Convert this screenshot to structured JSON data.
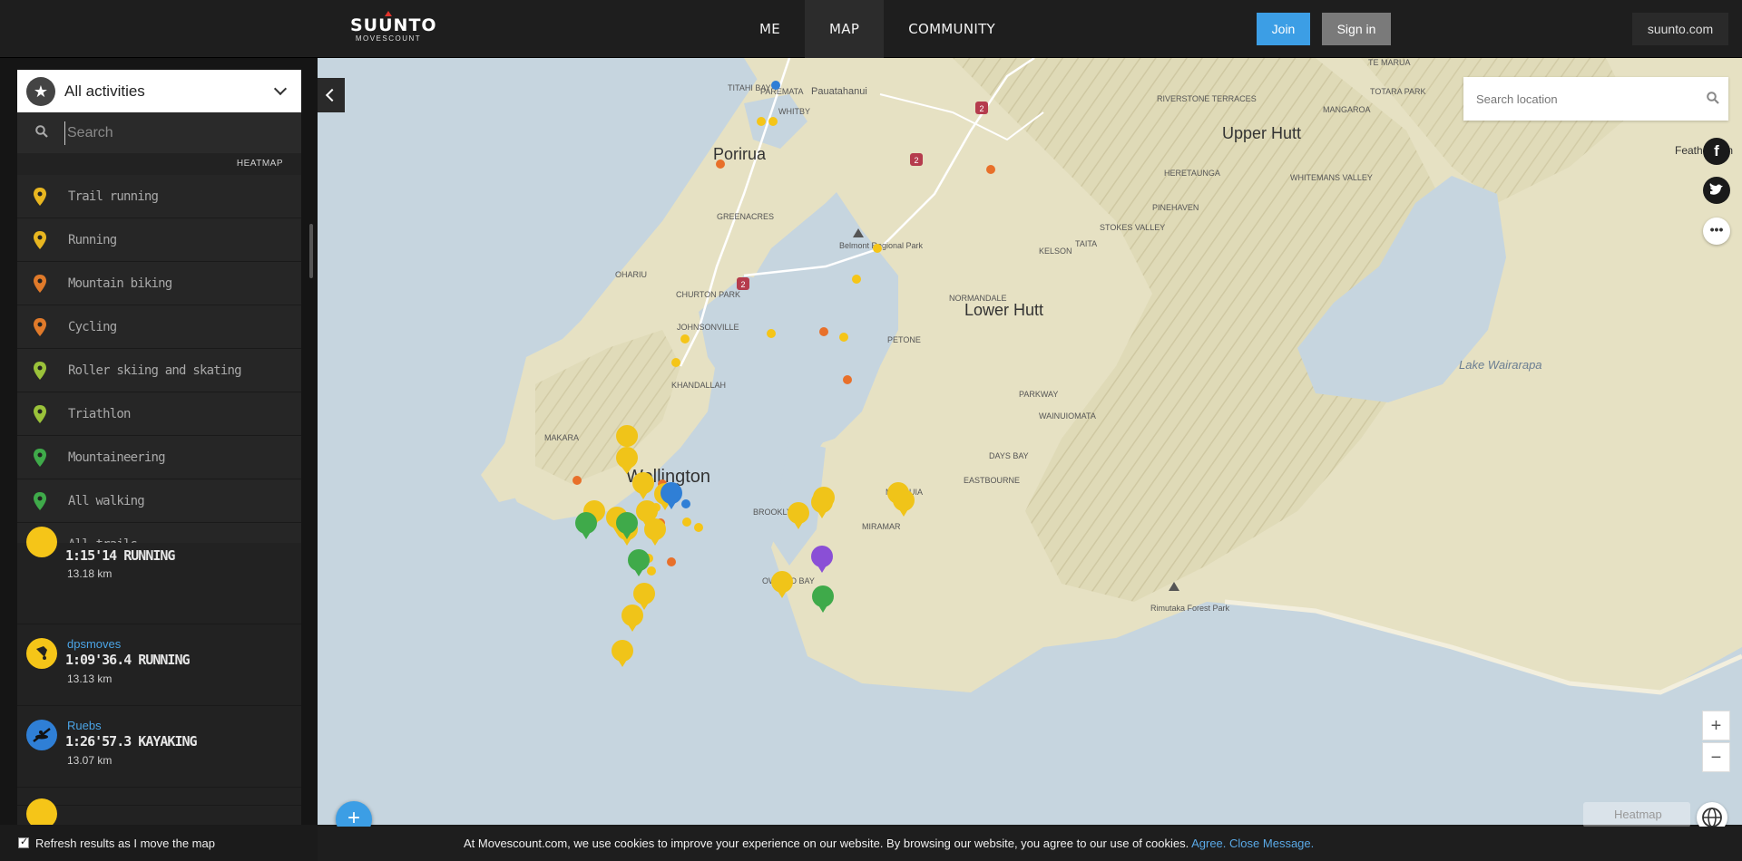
{
  "header": {
    "brand": "SUUNTO",
    "brand_sub": "MOVESCOUNT",
    "nav": [
      {
        "label": "ME"
      },
      {
        "label": "MAP"
      },
      {
        "label": "COMMUNITY"
      }
    ],
    "join_label": "Join",
    "signin_label": "Sign in",
    "site_link": "suunto.com"
  },
  "sidebar": {
    "activity_select": "All activities",
    "search_placeholder": "Search",
    "heatmap_header": "HEATMAP",
    "activities": [
      {
        "label": "Trail running",
        "color": "#e8b620"
      },
      {
        "label": "Running",
        "color": "#e8b620"
      },
      {
        "label": "Mountain biking",
        "color": "#e07a2a"
      },
      {
        "label": "Cycling",
        "color": "#e07a2a"
      },
      {
        "label": "Roller skiing and skating",
        "color": "#9ac23a"
      },
      {
        "label": "Triathlon",
        "color": "#9ac23a"
      },
      {
        "label": "Mountaineering",
        "color": "#3faa4a"
      },
      {
        "label": "All walking",
        "color": "#3faa4a"
      },
      {
        "label": "All trails",
        "color": "#3faa4a"
      }
    ],
    "feed": [
      {
        "user": "",
        "time": "1:15'14 RUNNING",
        "distance": "13.18 km",
        "color": "#f5c518"
      },
      {
        "user": "dpsmoves",
        "time": "1:09'36.4 RUNNING",
        "distance": "13.13 km",
        "color": "#f5c518"
      },
      {
        "user": "Ruebs",
        "time": "1:26'57.3 KAYAKING",
        "distance": "13.07 km",
        "color": "#2f7fd6"
      }
    ],
    "refresh_label": "Refresh results as I move the map",
    "refresh_checked": true
  },
  "map": {
    "search_placeholder": "Search location",
    "places": {
      "porirua": "Porirua",
      "upper_hutt": "Upper Hutt",
      "lower_hutt": "Lower Hutt",
      "wellington": "Wellington",
      "lake": "Lake Wairarapa",
      "belmont": "Belmont Regional Park",
      "rimutaka": "Rimutaka Forest Park",
      "titahi": "TITAHI BAY",
      "pauatahanui": "Pauatahanui",
      "whitby": "WHITBY",
      "paremata": "PAREMATA",
      "greenacres": "GREENACRES",
      "ohariu": "OHARIU",
      "churton": "CHURTON PARK",
      "johnsonville": "JOHNSONVILLE",
      "khandallah": "KHANDALLAH",
      "makara": "MAKARA",
      "normandale": "NORMANDALE",
      "petone": "PETONE",
      "kelson": "KELSON",
      "taita": "TAITA",
      "stokes": "STOKES VALLEY",
      "pinehaven": "PINEHAVEN",
      "heretaunga": "HERETAUNGA",
      "whitemans": "WHITEMANS VALLEY",
      "riverstone": "RIVERSTONE TERRACES",
      "totara": "TOTARA PARK",
      "mangaroa": "MANGAROA",
      "temara": "TE MARUA",
      "wainuiomata": "WAINUIOMATA",
      "parkway": "PARKWAY",
      "eastbourne": "EASTBOURNE",
      "days_bay": "DAYS BAY",
      "maupuia": "MAUPUIA",
      "miramar": "MIRAMAR",
      "brooklyn": "BROOKLYN",
      "owhiro": "OWHIRO BAY",
      "featherston": "Featherston"
    },
    "highway_labels": [
      "2",
      "2",
      "2"
    ],
    "heatmap_toggle": "Heatmap",
    "zoom_in": "+",
    "zoom_out": "−",
    "add_label": "+"
  },
  "cookie": {
    "message": "At Movescount.com, we use cookies to improve your experience on our website. By browsing our website, you agree to our use of cookies.",
    "agree": "Agree.",
    "close": "Close Message."
  },
  "colors": {
    "running": "#f5c518",
    "walking": "#3faa4a",
    "kayaking": "#2f7fd6",
    "cycling": "#e8702a",
    "other": "#8a4fd6",
    "accent": "#3c9ee5"
  }
}
